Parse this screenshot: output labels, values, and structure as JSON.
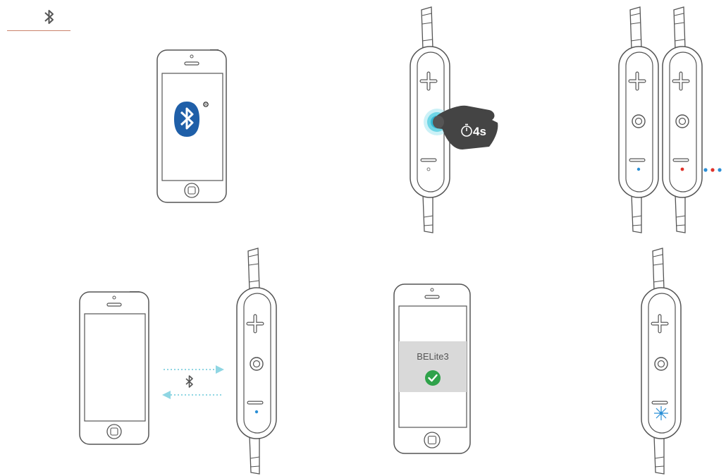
{
  "header": {
    "icon": "bluetooth-icon"
  },
  "pairing_screen": {
    "device_name": "BELite3",
    "status_icon": "check-circle-icon",
    "status_color": "#2fa24a"
  },
  "press_hold": {
    "duration_label": "4s",
    "icon": "stopwatch-icon"
  },
  "colors": {
    "bluetooth_blue": "#1f5fa8",
    "led_blue": "#2b8fd6",
    "led_red": "#e0322a",
    "glow_cyan": "#32b8d4",
    "signal_dashes": "#8fd6e3",
    "outline": "#555555",
    "accent_line": "#c9826b"
  }
}
